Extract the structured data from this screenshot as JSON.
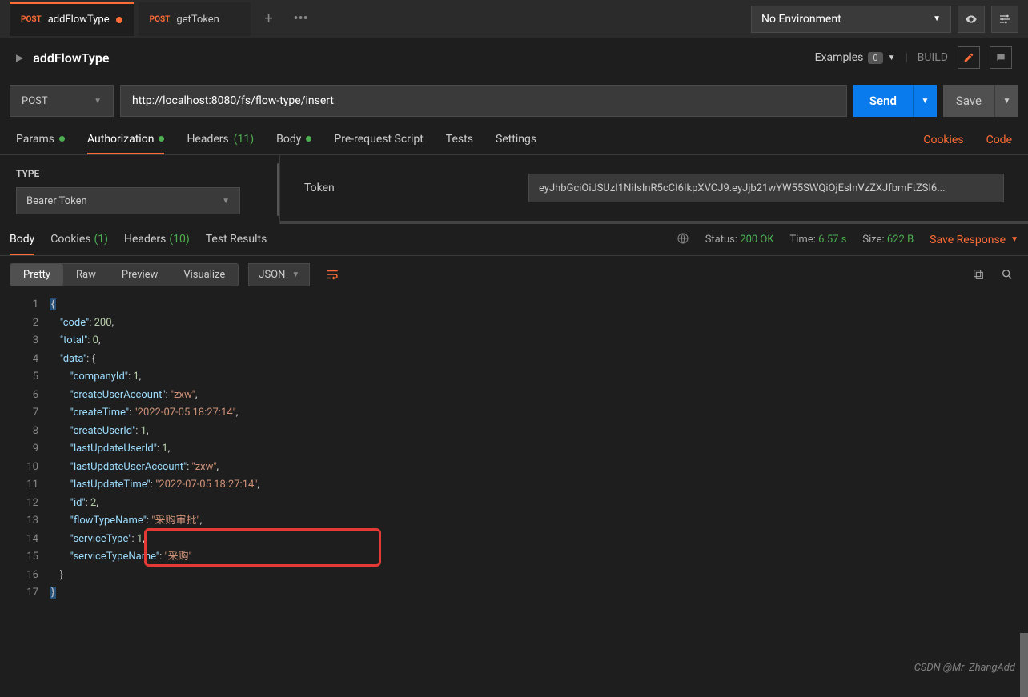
{
  "topbar": {
    "tabs": [
      {
        "method": "POST",
        "label": "addFlowType",
        "active": true,
        "dirty": true
      },
      {
        "method": "POST",
        "label": "getToken",
        "active": false,
        "dirty": false
      }
    ],
    "environment": "No Environment"
  },
  "request": {
    "name": "addFlowType",
    "examples_label": "Examples",
    "examples_count": "0",
    "build_label": "BUILD",
    "method": "POST",
    "url": "http://localhost:8080/fs/flow-type/insert",
    "send_label": "Send",
    "save_label": "Save"
  },
  "req_tabs": {
    "params": "Params",
    "authorization": "Authorization",
    "headers": "Headers",
    "headers_count": "(11)",
    "body": "Body",
    "prerequest": "Pre-request Script",
    "tests": "Tests",
    "settings": "Settings",
    "cookies": "Cookies",
    "code": "Code"
  },
  "auth": {
    "type_label": "TYPE",
    "type_value": "Bearer Token",
    "token_label": "Token",
    "token_value": "eyJhbGciOiJSUzI1NiIsInR5cCI6IkpXVCJ9.eyJjb21wYW55SWQiOjEsInVzZXJfbmFtZSI6..."
  },
  "resp_tabs": {
    "body": "Body",
    "cookies": "Cookies",
    "cookies_count": "(1)",
    "headers": "Headers",
    "headers_count": "(10)",
    "test_results": "Test Results",
    "status_label": "Status:",
    "status_value": "200 OK",
    "time_label": "Time:",
    "time_value": "6.57 s",
    "size_label": "Size:",
    "size_value": "622 B",
    "save_response": "Save Response"
  },
  "view": {
    "pretty": "Pretty",
    "raw": "Raw",
    "preview": "Preview",
    "visualize": "Visualize",
    "format": "JSON"
  },
  "response_json": {
    "lines": [
      "{",
      "    \"code\": 200,",
      "    \"total\": 0,",
      "    \"data\": {",
      "        \"companyId\": 1,",
      "        \"createUserAccount\": \"zxw\",",
      "        \"createTime\": \"2022-07-05 18:27:14\",",
      "        \"createUserId\": 1,",
      "        \"lastUpdateUserId\": 1,",
      "        \"lastUpdateUserAccount\": \"zxw\",",
      "        \"lastUpdateTime\": \"2022-07-05 18:27:14\",",
      "        \"id\": 2,",
      "        \"flowTypeName\": \"采购审批\",",
      "        \"serviceType\": 1,",
      "        \"serviceTypeName\": \"采购\"",
      "    }",
      "}"
    ]
  },
  "watermark": "CSDN @Mr_ZhangAdd"
}
